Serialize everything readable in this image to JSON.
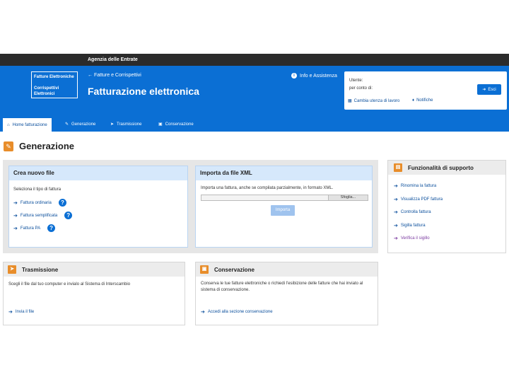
{
  "topbar": {
    "org": "Agenzia delle Entrate"
  },
  "header": {
    "logo_line1": "Fatture Elettroniche",
    "logo_line2": "Corrispettivi",
    "logo_line3": "Elettronici",
    "back_link": "Fatture e Corrispettivi",
    "app_title": "Fatturazione elettronica",
    "info_link": "Info e Assistenza"
  },
  "user": {
    "label_user": "Utente:",
    "label_for": "per conto di:",
    "exit_label": "Esci",
    "change_workspace": "Cambia utenza di lavoro",
    "notifications": "Notifiche"
  },
  "nav": {
    "tabs": [
      {
        "label": "Home fatturazione"
      },
      {
        "label": "Generazione"
      },
      {
        "label": "Trasmissione"
      },
      {
        "label": "Conservazione"
      }
    ]
  },
  "section": {
    "title": "Generazione"
  },
  "create": {
    "title": "Crea nuovo file",
    "subtitle": "Seleziona il tipo di fattura",
    "links": [
      "Fattura ordinaria",
      "Fattura semplificata",
      "Fattura PA"
    ]
  },
  "import": {
    "title": "Importa da file XML",
    "text": "Importa una fattura, anche se compilata parzialmente, in formato XML.",
    "file_button": "Sfoglia...",
    "import_button": "Importa"
  },
  "support": {
    "title": "Funzionalità di supporto",
    "links": [
      "Rinomina la fattura",
      "Visualizza PDF fattura",
      "Controlla fattura",
      "Sigilla fattura",
      "Verifica il sigillo"
    ]
  },
  "transmission": {
    "title": "Trasmissione",
    "text": "Scegli il file dal tuo computer e invialo al Sistema di Interscambio",
    "link": "Invia il file"
  },
  "conservation": {
    "title": "Conservazione",
    "text": "Conserva le tue fatture elettroniche o richiedi l'esibizione delle fatture che hai inviato al sistema di conservazione.",
    "link": "Accedi alla sezione conservazione"
  },
  "colors": {
    "primary": "#0b6fd4",
    "accent": "#e88d2a",
    "card_head": "#d6e8fb"
  }
}
